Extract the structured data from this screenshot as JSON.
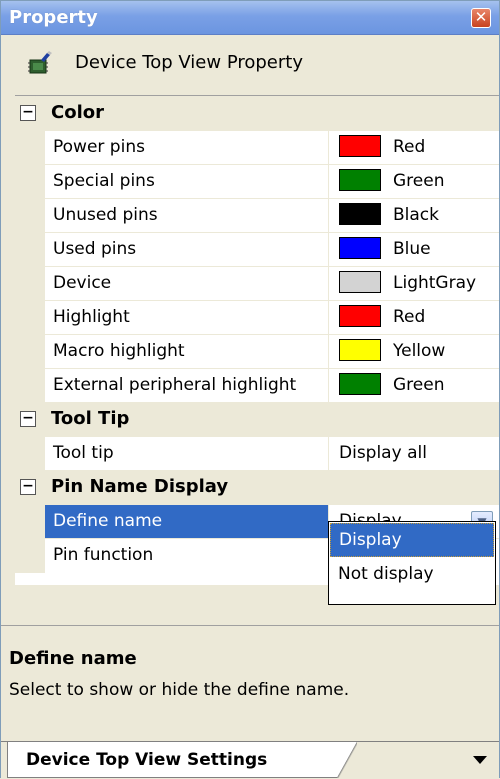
{
  "window": {
    "title": "Property"
  },
  "header": {
    "object_title": "Device Top View Property",
    "icon": "device-chip-icon"
  },
  "categories": {
    "color": {
      "label": "Color",
      "items": [
        {
          "name": "Power pins",
          "value": "Red",
          "color": "#ff0000"
        },
        {
          "name": "Special pins",
          "value": "Green",
          "color": "#008000"
        },
        {
          "name": "Unused pins",
          "value": "Black",
          "color": "#000000"
        },
        {
          "name": "Used pins",
          "value": "Blue",
          "color": "#0000ff"
        },
        {
          "name": "Device",
          "value": "LightGray",
          "color": "#d3d3d3"
        },
        {
          "name": "Highlight",
          "value": "Red",
          "color": "#ff0000"
        },
        {
          "name": "Macro highlight",
          "value": "Yellow",
          "color": "#ffff00"
        },
        {
          "name": "External peripheral highlight",
          "value": "Green",
          "color": "#008000"
        }
      ]
    },
    "tooltip": {
      "label": "Tool Tip",
      "items": [
        {
          "name": "Tool tip",
          "value": "Display all"
        }
      ]
    },
    "pinname": {
      "label": "Pin Name Display",
      "items": [
        {
          "name": "Define name",
          "value": "Display"
        },
        {
          "name": "Pin function",
          "value": ""
        }
      ]
    }
  },
  "dropdown": {
    "options": [
      "Display",
      "Not display"
    ],
    "selected": "Display"
  },
  "description": {
    "title": "Define name",
    "text": "Select to show or hide the define name."
  },
  "tabs": {
    "active": "Device Top View Settings"
  },
  "colors": {
    "selection": "#316ac5",
    "titlebar": "#7aa0e6"
  }
}
